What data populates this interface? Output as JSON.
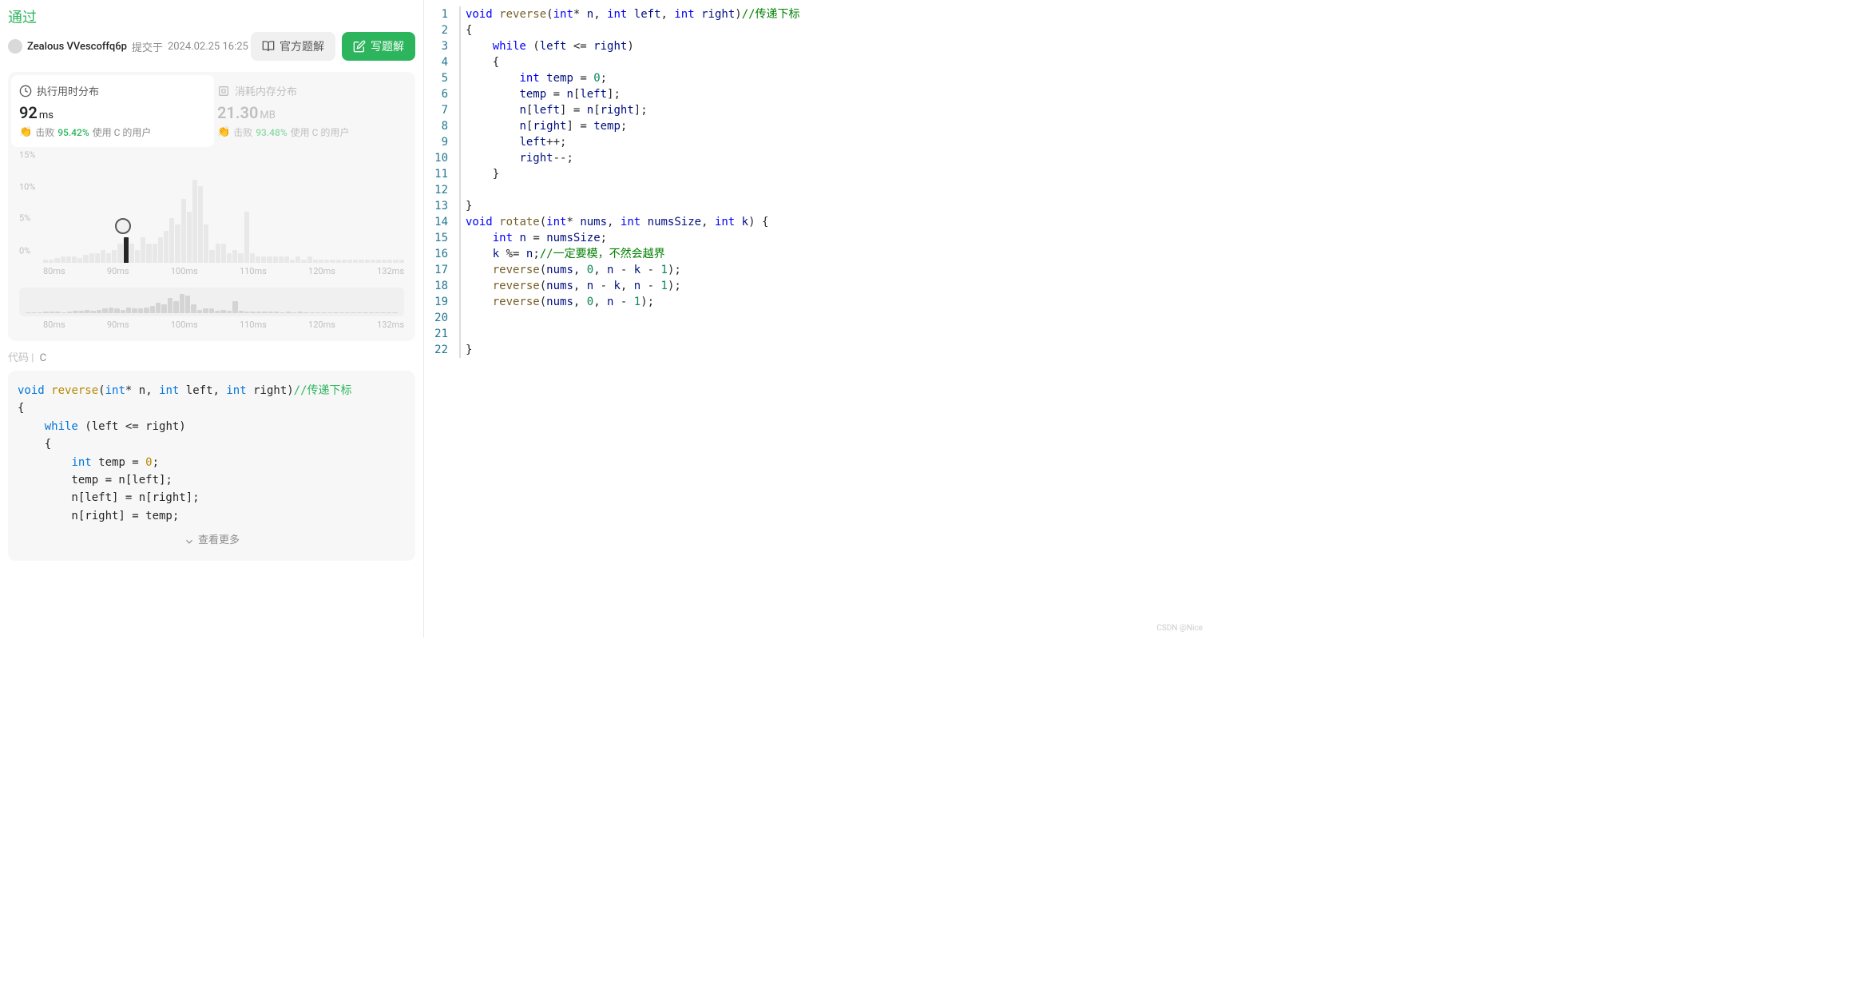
{
  "status": "通过",
  "author": "Zealous VVescoffq6p",
  "submit_prefix": "提交于",
  "submit_time": "2024.02.25 16:25",
  "buttons": {
    "official": "官方题解",
    "write": "写题解"
  },
  "stats": {
    "runtime": {
      "label": "执行用时分布",
      "value": "92",
      "unit": "ms",
      "beat_label": "击败",
      "beat_pct": "95.42%",
      "beat_suffix": "使用 C 的用户"
    },
    "memory": {
      "label": "消耗内存分布",
      "value": "21.30",
      "unit": "MB",
      "beat_label": "击败",
      "beat_pct": "93.48%",
      "beat_suffix": "使用 C 的用户"
    }
  },
  "chart_data": {
    "type": "bar",
    "xlabel": "ms",
    "ylabel": "%",
    "y_ticks": [
      "15%",
      "10%",
      "5%",
      "0%"
    ],
    "x_ticks": [
      "80ms",
      "90ms",
      "100ms",
      "110ms",
      "120ms",
      "132ms"
    ],
    "bars": [
      0.5,
      0.5,
      0.8,
      1,
      1,
      1,
      0.8,
      1.2,
      1.5,
      1.5,
      2,
      1.5,
      2,
      3,
      4,
      3,
      2,
      4,
      3,
      3,
      4,
      5,
      7,
      6,
      10,
      8,
      13,
      12,
      6,
      2,
      3,
      3,
      1.5,
      2,
      1.5,
      8,
      1.5,
      1,
      1,
      1,
      1,
      1,
      1,
      0.5,
      1,
      0.5,
      1,
      0.5,
      0.5,
      0.5,
      0.5,
      0.5,
      0.5,
      0.5,
      0.5,
      0.5,
      0.5,
      0.5,
      0.5,
      0.5,
      0.5,
      0.5,
      0.5
    ],
    "current_index": 14,
    "mini_bars": [
      0.5,
      0.5,
      0.8,
      1,
      1,
      1,
      0.8,
      1.2,
      1.5,
      1.5,
      2,
      1.5,
      2,
      3,
      4,
      3,
      2,
      4,
      3,
      3,
      4,
      5,
      7,
      6,
      10,
      8,
      13,
      12,
      6,
      2,
      3,
      3,
      1.5,
      2,
      1.5,
      8,
      1.5,
      1,
      1,
      1,
      1,
      1,
      1,
      0.5,
      1,
      0.5,
      1,
      0.5,
      0.5,
      0.5,
      0.5,
      0.5,
      0.5,
      0.5,
      0.5,
      0.5,
      0.5,
      0.5,
      0.5,
      0.5,
      0.5,
      0.5,
      0.5
    ]
  },
  "code_section": {
    "label": "代码",
    "lang": "C",
    "show_more": "查看更多"
  },
  "left_code": {
    "l1": "void reverse(int* n, int left, int right)//传递下标",
    "l2": "{",
    "l3": "    while (left <= right)",
    "l4": "    {",
    "l5": "        int temp = 0;",
    "l6": "        temp = n[left];",
    "l7": "        n[left] = n[right];",
    "l8": "        n[right] = temp;"
  },
  "editor_lines": [
    {
      "n": 1,
      "html": "<span class='tok-kw'>void</span> <span class='tok-fn'>reverse</span>(<span class='tok-ty'>int</span>* <span class='tok-var'>n</span>, <span class='tok-ty'>int</span> <span class='tok-var'>left</span>, <span class='tok-ty'>int</span> <span class='tok-var'>right</span>)<span class='tok-cm'>//传递下标</span>"
    },
    {
      "n": 2,
      "html": "{"
    },
    {
      "n": 3,
      "html": "    <span class='tok-kw'>while</span> (<span class='tok-var'>left</span> &lt;= <span class='tok-var'>right</span>)"
    },
    {
      "n": 4,
      "html": "    {"
    },
    {
      "n": 5,
      "html": "        <span class='tok-ty'>int</span> <span class='tok-var'>temp</span> = <span class='tok-num'>0</span>;"
    },
    {
      "n": 6,
      "html": "        <span class='tok-var'>temp</span> = <span class='tok-var'>n</span>[<span class='tok-var'>left</span>];"
    },
    {
      "n": 7,
      "html": "        <span class='tok-var'>n</span>[<span class='tok-var'>left</span>] = <span class='tok-var'>n</span>[<span class='tok-var'>right</span>];"
    },
    {
      "n": 8,
      "html": "        <span class='tok-var'>n</span>[<span class='tok-var'>right</span>] = <span class='tok-var'>temp</span>;"
    },
    {
      "n": 9,
      "html": "        <span class='tok-var'>left</span>++;"
    },
    {
      "n": 10,
      "html": "        <span class='tok-var'>right</span>--;"
    },
    {
      "n": 11,
      "html": "    }"
    },
    {
      "n": 12,
      "html": ""
    },
    {
      "n": 13,
      "html": "}"
    },
    {
      "n": 14,
      "html": "<span class='tok-kw'>void</span> <span class='tok-fn'>rotate</span>(<span class='tok-ty'>int</span>* <span class='tok-var'>nums</span>, <span class='tok-ty'>int</span> <span class='tok-var'>numsSize</span>, <span class='tok-ty'>int</span> <span class='tok-var'>k</span>) {"
    },
    {
      "n": 15,
      "html": "    <span class='tok-ty'>int</span> <span class='tok-var'>n</span> = <span class='tok-var'>numsSize</span>;"
    },
    {
      "n": 16,
      "html": "    <span class='tok-var'>k</span> %= <span class='tok-var'>n</span>;<span class='tok-cm'>//一定要模，不然会越界</span>"
    },
    {
      "n": 17,
      "html": "    <span class='tok-fn'>reverse</span>(<span class='tok-var'>nums</span>, <span class='tok-num'>0</span>, <span class='tok-var'>n</span> - <span class='tok-var'>k</span> - <span class='tok-num'>1</span>);"
    },
    {
      "n": 18,
      "html": "    <span class='tok-fn'>reverse</span>(<span class='tok-var'>nums</span>, <span class='tok-var'>n</span> - <span class='tok-var'>k</span>, <span class='tok-var'>n</span> - <span class='tok-num'>1</span>);"
    },
    {
      "n": 19,
      "html": "    <span class='tok-fn'>reverse</span>(<span class='tok-var'>nums</span>, <span class='tok-num'>0</span>, <span class='tok-var'>n</span> - <span class='tok-num'>1</span>);"
    },
    {
      "n": 20,
      "html": ""
    },
    {
      "n": 21,
      "html": ""
    },
    {
      "n": 22,
      "html": "}"
    }
  ],
  "watermark": "CSDN @Nice"
}
